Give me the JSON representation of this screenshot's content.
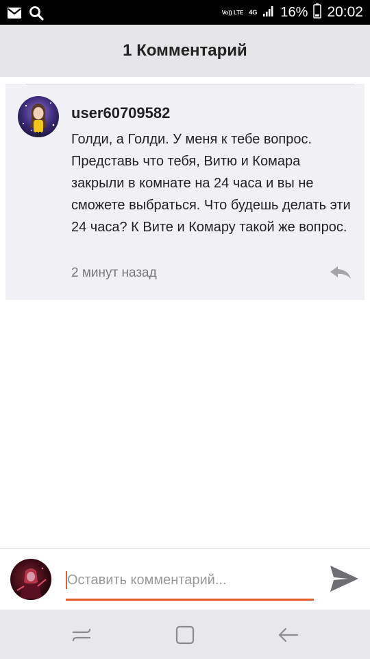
{
  "status_bar": {
    "volte_label": "Vo)) LTE",
    "network_label": "4G",
    "battery_percent": "16%",
    "time": "20:02"
  },
  "header": {
    "title": "1 Комментарий"
  },
  "comment": {
    "username": "user60709582",
    "text": "Голди, а Голди. У меня к тебе вопрос. Представь что тебя, Витю и Комара закрыли в комнате на 24 часа и вы не сможете выбраться. Что будешь делать эти 24 часа? К Вите и Комару такой же вопрос.",
    "time": "2 минут назад"
  },
  "input": {
    "placeholder": "Оставить комментарий...",
    "value": ""
  },
  "colors": {
    "accent": "#e85a26",
    "header_bg": "#e6e6e9",
    "card_bg": "#f1f1f5",
    "navbar_bg": "#e8e8ea"
  },
  "icons": {
    "status_left": [
      "mail-icon",
      "search-icon"
    ],
    "status_right": [
      "signal-icon",
      "battery-icon"
    ],
    "comment": [
      "reply-icon"
    ],
    "input": [
      "send-icon"
    ],
    "nav": [
      "recent-apps-icon",
      "home-icon",
      "back-icon"
    ]
  }
}
